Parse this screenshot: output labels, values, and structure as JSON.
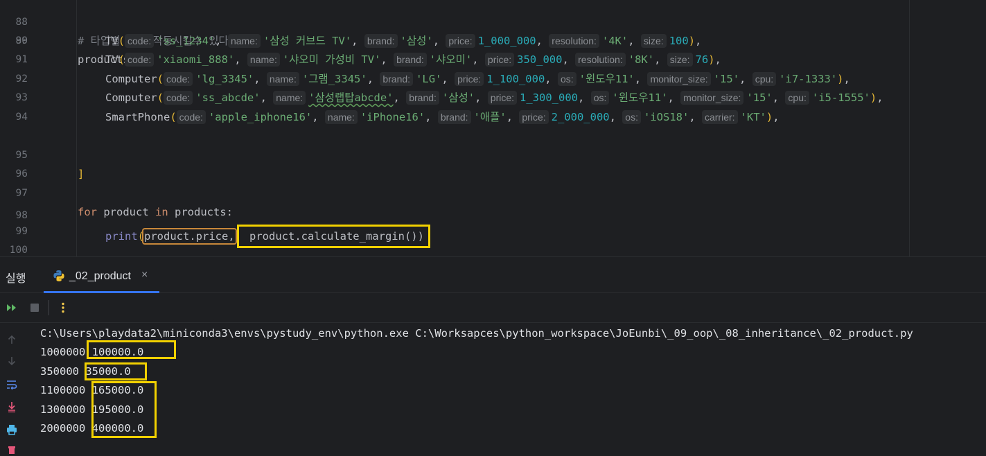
{
  "editor": {
    "lines": [
      {
        "n": "88",
        "comment": "# 타입별 달리 작동시킬수 있다."
      },
      {
        "n": "89",
        "var": "products",
        "eq": " = ",
        "open": "["
      },
      {
        "n": "90",
        "cls": "TV",
        "args": [
          {
            "hint": "code:",
            "val": "'ss_1234'",
            "t": "str"
          },
          {
            "hint": "name:",
            "val": "'삼성 커브드 TV'",
            "t": "str"
          },
          {
            "hint": "brand:",
            "val": "'삼성'",
            "t": "str"
          },
          {
            "hint": "price:",
            "val": "1_000_000",
            "t": "num"
          },
          {
            "hint": "resolution:",
            "val": "'4K'",
            "t": "str"
          },
          {
            "hint": "size:",
            "val": "100",
            "t": "num"
          }
        ]
      },
      {
        "n": "91",
        "cls": "TV",
        "args": [
          {
            "hint": "code:",
            "val": "'xiaomi_888'",
            "t": "str"
          },
          {
            "hint": "name:",
            "val": "'샤오미 가성비 TV'",
            "t": "str"
          },
          {
            "hint": "brand:",
            "val": "'샤오미'",
            "t": "str"
          },
          {
            "hint": "price:",
            "val": "350_000",
            "t": "num"
          },
          {
            "hint": "resolution:",
            "val": "'8K'",
            "t": "str"
          },
          {
            "hint": "size:",
            "val": "76",
            "t": "num"
          }
        ]
      },
      {
        "n": "92",
        "cls": "Computer",
        "args": [
          {
            "hint": "code:",
            "val": "'lg_3345'",
            "t": "str"
          },
          {
            "hint": "name:",
            "val": "'그램_3345'",
            "t": "str"
          },
          {
            "hint": "brand:",
            "val": "'LG'",
            "t": "str"
          },
          {
            "hint": "price:",
            "val": "1_100_000",
            "t": "num"
          },
          {
            "hint": "os:",
            "val": "'윈도우11'",
            "t": "str"
          },
          {
            "hint": "monitor_size:",
            "val": "'15'",
            "t": "str"
          },
          {
            "hint": "cpu:",
            "val": "'i7-1333'",
            "t": "str"
          }
        ]
      },
      {
        "n": "93",
        "cls": "Computer",
        "args": [
          {
            "hint": "code:",
            "val": "'ss_abcde'",
            "t": "str"
          },
          {
            "hint": "name:",
            "val": "'삼성랩탑abcde'",
            "t": "str",
            "wavy": true
          },
          {
            "hint": "brand:",
            "val": "'삼성'",
            "t": "str"
          },
          {
            "hint": "price:",
            "val": "1_300_000",
            "t": "num"
          },
          {
            "hint": "os:",
            "val": "'윈도우11'",
            "t": "str"
          },
          {
            "hint": "monitor_size:",
            "val": "'15'",
            "t": "str"
          },
          {
            "hint": "cpu:",
            "val": "'i5-1555'",
            "t": "str"
          }
        ]
      },
      {
        "n": "94",
        "cls": "SmartPhone",
        "args": [
          {
            "hint": "code:",
            "val": "'apple_iphone16'",
            "t": "str"
          },
          {
            "hint": "name:",
            "val": "'iPhone16'",
            "t": "str"
          },
          {
            "hint": "brand:",
            "val": "'애플'",
            "t": "str"
          },
          {
            "hint": "price:",
            "val": "2_000_000",
            "t": "num"
          },
          {
            "hint": "os:",
            "val": "'iOS18'",
            "t": "str"
          },
          {
            "hint": "carrier:",
            "val": "'KT'",
            "t": "str"
          }
        ]
      },
      {
        "n": "95",
        "close": "]"
      },
      {
        "n": "96"
      },
      {
        "n": "97",
        "for_kw": "for",
        "for_var": " product ",
        "in_kw": "in",
        "for_iter": " products:"
      },
      {
        "n": "98",
        "print_fn": "print",
        "arg1": "product.price,",
        "arg2": " product.calculate_margin())"
      },
      {
        "n": "99"
      },
      {
        "n": "100"
      }
    ]
  },
  "run_panel": {
    "title": "실행",
    "tab_label": "_02_product",
    "tab_close": "×",
    "command": "C:\\Users\\playdata2\\miniconda3\\envs\\pystudy_env\\python.exe C:\\Worksapces\\python_workspace\\JoEunbi\\_09_oop\\_08_inheritance\\_02_product.py",
    "output": [
      {
        "price": "1000000",
        "margin": "100000.0"
      },
      {
        "price": "350000",
        "margin": "35000.0"
      },
      {
        "price": "1100000",
        "margin": "165000.0"
      },
      {
        "price": "1300000",
        "margin": "195000.0"
      },
      {
        "price": "2000000",
        "margin": "400000.0"
      }
    ]
  },
  "icons": {
    "toolbar": [
      "rerun-icon",
      "stop-icon",
      "more-options-icon"
    ],
    "side": [
      "scroll-up-icon",
      "scroll-down-icon",
      "soft-wrap-icon",
      "scroll-to-end-icon",
      "print-icon"
    ]
  },
  "colors": {
    "highlight_box": "#f2d100",
    "highlight_box_orange": "#c8883a",
    "tab_underline": "#3574f0"
  }
}
